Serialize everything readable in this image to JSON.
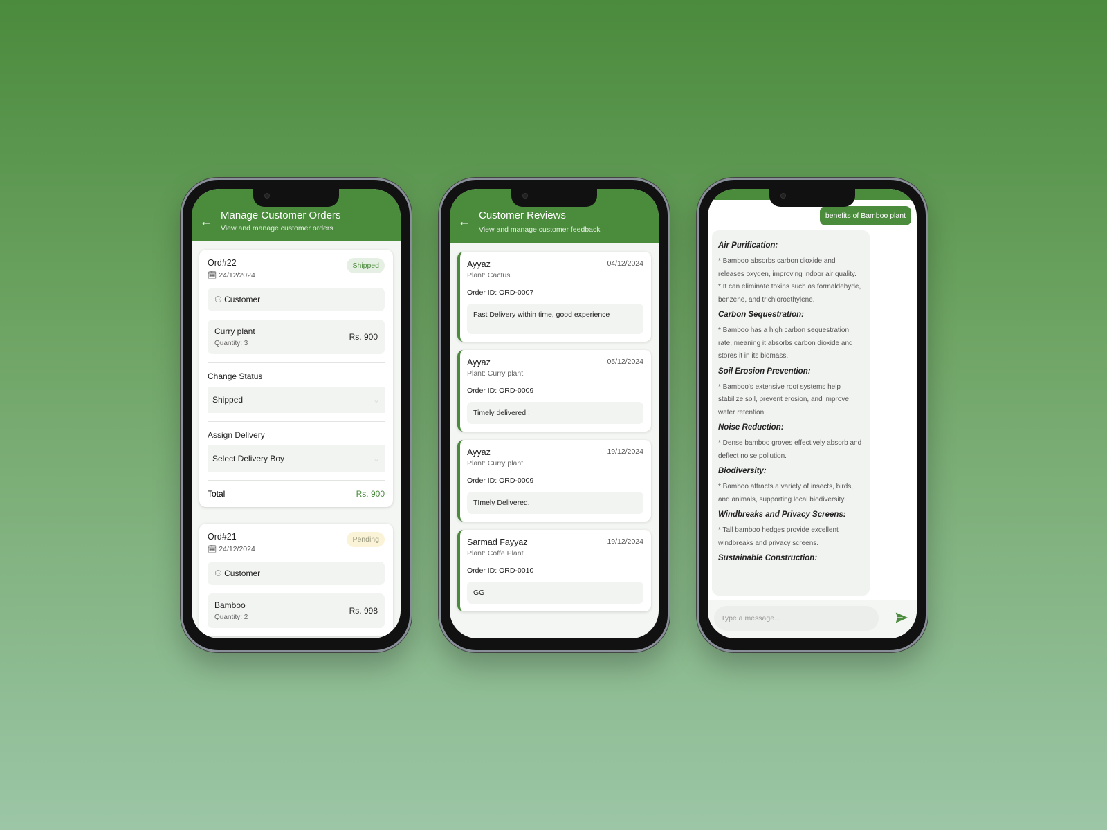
{
  "colors": {
    "primary": "#4a8b3c",
    "shipped_bg": "#e6efe3",
    "pending_bg": "#faf3d8"
  },
  "orders_screen": {
    "title": "Manage Customer Orders",
    "subtitle": "View and manage customer orders",
    "orders": [
      {
        "id": "Ord#22",
        "date": "24/12/2024",
        "status": "Shipped",
        "customer": "Customer",
        "item": "Curry plant",
        "quantity": "Quantity: 3",
        "price": "Rs. 900",
        "change_status_label": "Change Status",
        "status_value": "Shipped",
        "assign_label": "Assign Delivery",
        "delivery_value": "Select Delivery Boy",
        "total_label": "Total",
        "total": "Rs. 900"
      },
      {
        "id": "Ord#21",
        "date": "24/12/2024",
        "status": "Pending",
        "customer": "Customer",
        "item": "Bamboo",
        "quantity": "Quantity: 2",
        "price": "Rs. 998"
      }
    ]
  },
  "reviews_screen": {
    "title": "Customer Reviews",
    "subtitle": "View and manage customer feedback",
    "reviews": [
      {
        "name": "Ayyaz",
        "date": "04/12/2024",
        "plant": "Plant: Cactus",
        "order": "Order ID: ORD-0007",
        "comment": "Fast Delivery within time, good experience"
      },
      {
        "name": "Ayyaz",
        "date": "05/12/2024",
        "plant": "Plant: Curry plant",
        "order": "Order ID: ORD-0009",
        "comment": "Timely delivered !"
      },
      {
        "name": "Ayyaz",
        "date": "19/12/2024",
        "plant": "Plant: Curry plant",
        "order": "Order ID: ORD-0009",
        "comment": "TImely Delivered."
      },
      {
        "name": "Sarmad Fayyaz",
        "date": "19/12/2024",
        "plant": "Plant: Coffe Plant",
        "order": "Order ID: ORD-0010",
        "comment": "GG"
      }
    ]
  },
  "chat_screen": {
    "user_message": "benefits of Bamboo plant",
    "sections": [
      {
        "heading": "Air Purification:",
        "lines": [
          "* Bamboo absorbs carbon dioxide and releases oxygen, improving indoor air quality.",
          "* It can eliminate toxins such as formaldehyde, benzene, and trichloroethylene."
        ]
      },
      {
        "heading": "Carbon Sequestration:",
        "lines": [
          "* Bamboo has a high carbon sequestration rate, meaning it absorbs carbon dioxide and stores it in its biomass."
        ]
      },
      {
        "heading": "Soil Erosion Prevention:",
        "lines": [
          "* Bamboo's extensive root systems help stabilize soil, prevent erosion, and improve water retention."
        ]
      },
      {
        "heading": "Noise Reduction:",
        "lines": [
          "* Dense bamboo groves effectively absorb and deflect noise pollution."
        ]
      },
      {
        "heading": "Biodiversity:",
        "lines": [
          "* Bamboo attracts a variety of insects, birds, and animals, supporting local biodiversity."
        ]
      },
      {
        "heading": "Windbreaks and Privacy Screens:",
        "lines": [
          "* Tall bamboo hedges provide excellent windbreaks and privacy screens."
        ]
      },
      {
        "heading": "Sustainable Construction:",
        "lines": []
      }
    ],
    "input_placeholder": "Type a message..."
  }
}
